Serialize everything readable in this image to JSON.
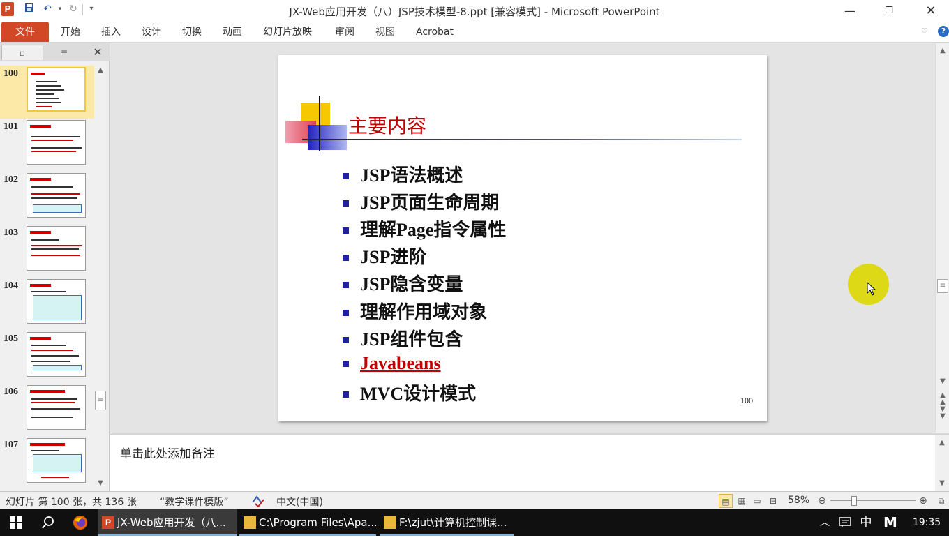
{
  "window": {
    "title": "JX-Web应用开发（八）JSP技术模型-8.ppt [兼容模式]  -  Microsoft PowerPoint",
    "app_icon_letter": "P"
  },
  "ribbon": {
    "file_label": "文件",
    "tabs": [
      "开始",
      "插入",
      "设计",
      "切换",
      "动画",
      "幻灯片放映",
      "审阅",
      "视图",
      "Acrobat"
    ]
  },
  "thumbnails": {
    "numbers": [
      "100",
      "101",
      "102",
      "103",
      "104",
      "105",
      "106",
      "107"
    ],
    "selected": "100"
  },
  "slide": {
    "title": "主要内容",
    "bullets": [
      "JSP语法概述",
      "JSP页面生命周期",
      "理解Page指令属性",
      "JSP进阶",
      "JSP隐含变量",
      "理解作用域对象",
      "JSP组件包含",
      "Javabeans",
      "MVC设计模式"
    ],
    "link_bullet_index": 7,
    "page_number": "100",
    "colors": {
      "title": "#c00000",
      "bullet_square": "#2020a0",
      "link": "#c00000"
    }
  },
  "notes": {
    "placeholder": "单击此处添加备注"
  },
  "status": {
    "slide_info": "幻灯片 第 100 张，共 136 张",
    "theme": "“教学课件模版”",
    "language": "中文(中国)",
    "zoom": "58%"
  },
  "taskbar": {
    "tasks": [
      "JX-Web应用开发（八...",
      "C:\\Program Files\\Apa...",
      "F:\\zjut\\计算机控制课..."
    ],
    "ime": "中",
    "ime2": "M",
    "time": "19:35"
  }
}
